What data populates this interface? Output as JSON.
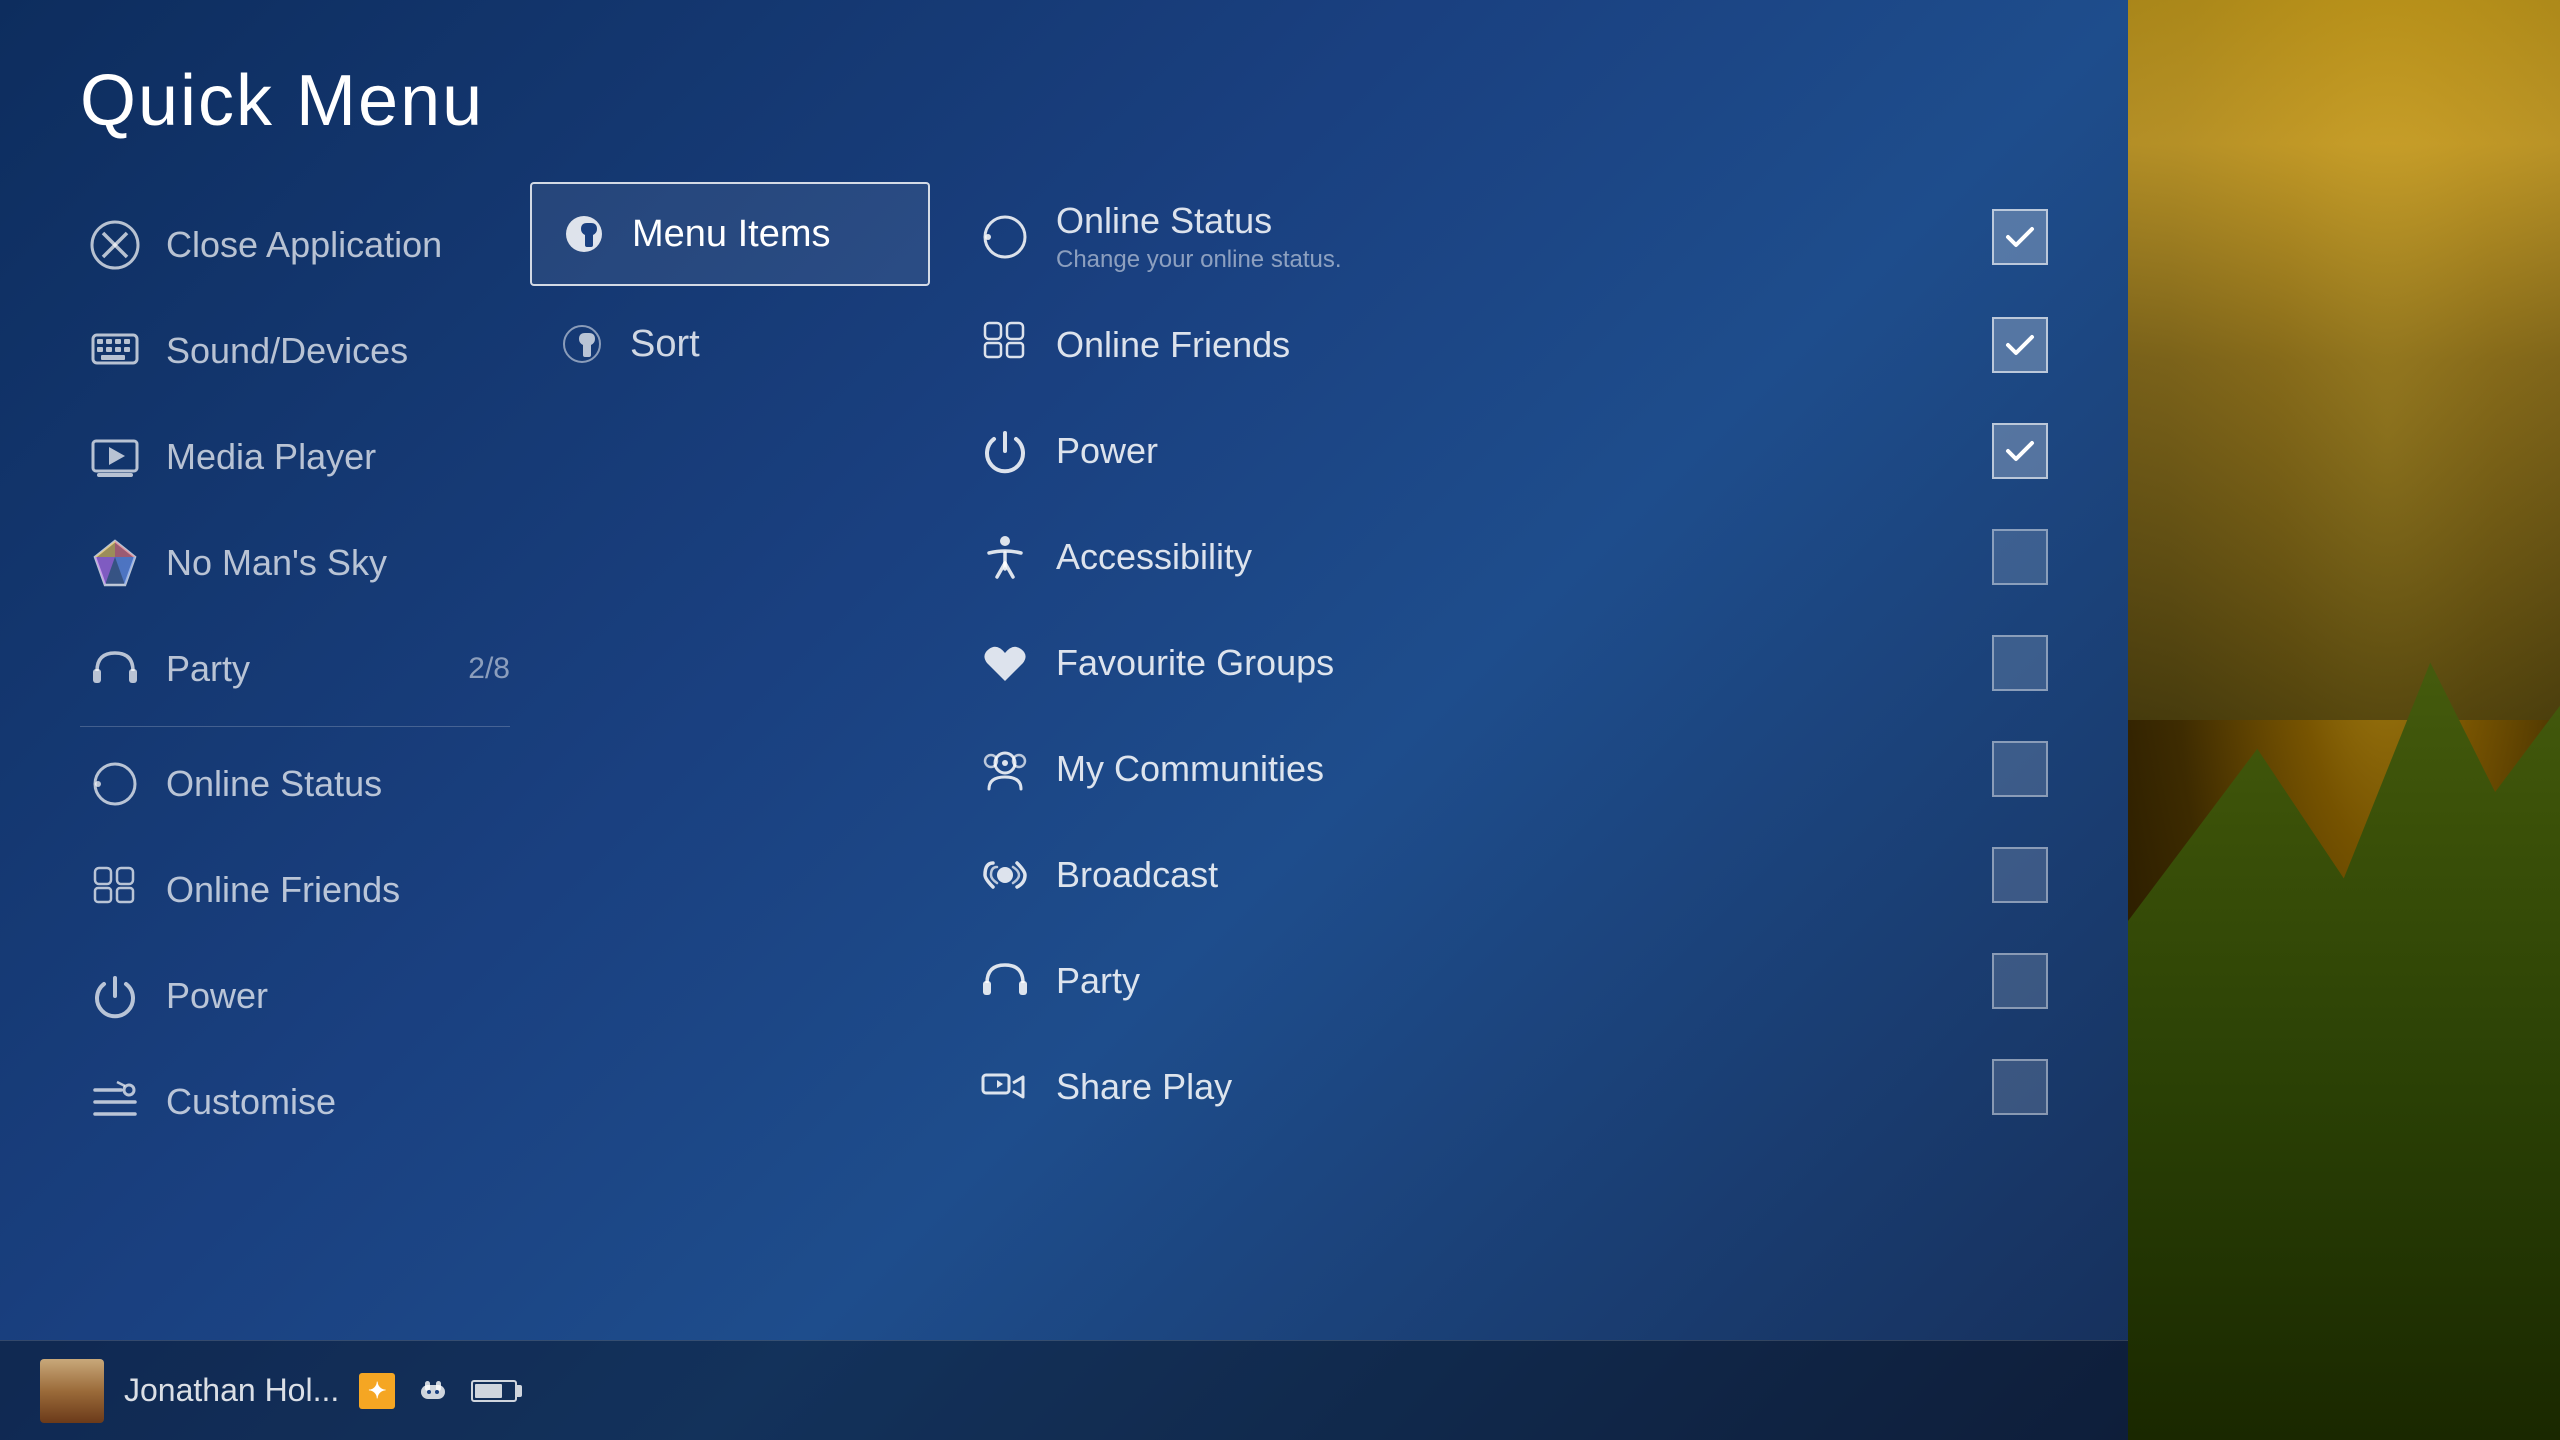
{
  "title": "Quick Menu",
  "colors": {
    "bg_dark": "#0d2d5e",
    "bg_mid": "#1a4080",
    "accent_blue": "#1e4d8c",
    "text_dim": "rgba(255,255,255,0.7)",
    "text_bright": "#ffffff",
    "checkbox_active": "rgba(255,255,255,0.25)"
  },
  "left_menu": {
    "items": [
      {
        "id": "close-application",
        "label": "Close Application",
        "icon": "cancel-circle"
      },
      {
        "id": "sound-devices",
        "label": "Sound/Devices",
        "icon": "keyboard"
      },
      {
        "id": "media-player",
        "label": "Media Player",
        "icon": "media"
      },
      {
        "id": "no-mans-sky",
        "label": "No Man's Sky",
        "icon": "game"
      },
      {
        "id": "party",
        "label": "Party",
        "icon": "headset",
        "badge": "2/8"
      }
    ],
    "divider": true,
    "items_bottom": [
      {
        "id": "online-status",
        "label": "Online Status",
        "icon": "face-status"
      },
      {
        "id": "online-friends",
        "label": "Online Friends",
        "icon": "friends"
      },
      {
        "id": "power",
        "label": "Power",
        "icon": "power"
      },
      {
        "id": "customise",
        "label": "Customise",
        "icon": "customise"
      }
    ]
  },
  "middle_menu": {
    "items": [
      {
        "id": "menu-items",
        "label": "Menu Items",
        "icon": "wrench",
        "active": true
      },
      {
        "id": "sort",
        "label": "Sort",
        "icon": "wrench",
        "active": false
      }
    ]
  },
  "settings_panel": {
    "items": [
      {
        "id": "online-status",
        "label": "Online Status",
        "desc": "Change your online status.",
        "icon": "face-status",
        "checked": true
      },
      {
        "id": "online-friends",
        "label": "Online Friends",
        "desc": "",
        "icon": "friends",
        "checked": true
      },
      {
        "id": "power",
        "label": "Power",
        "desc": "",
        "icon": "power",
        "checked": true
      },
      {
        "id": "accessibility",
        "label": "Accessibility",
        "desc": "",
        "icon": "accessibility",
        "checked": false
      },
      {
        "id": "favourite-groups",
        "label": "Favourite Groups",
        "desc": "",
        "icon": "heart",
        "checked": false
      },
      {
        "id": "my-communities",
        "label": "My Communities",
        "desc": "",
        "icon": "communities",
        "checked": false
      },
      {
        "id": "broadcast",
        "label": "Broadcast",
        "desc": "",
        "icon": "broadcast",
        "checked": false
      },
      {
        "id": "party",
        "label": "Party",
        "desc": "",
        "icon": "headset",
        "checked": false
      },
      {
        "id": "share-play",
        "label": "Share Play",
        "desc": "",
        "icon": "share-play",
        "checked": false
      }
    ]
  },
  "status_bar": {
    "username": "Jonathan Hol...",
    "ps_plus": "＋",
    "controller_icon": "controller",
    "battery_level": 70
  }
}
